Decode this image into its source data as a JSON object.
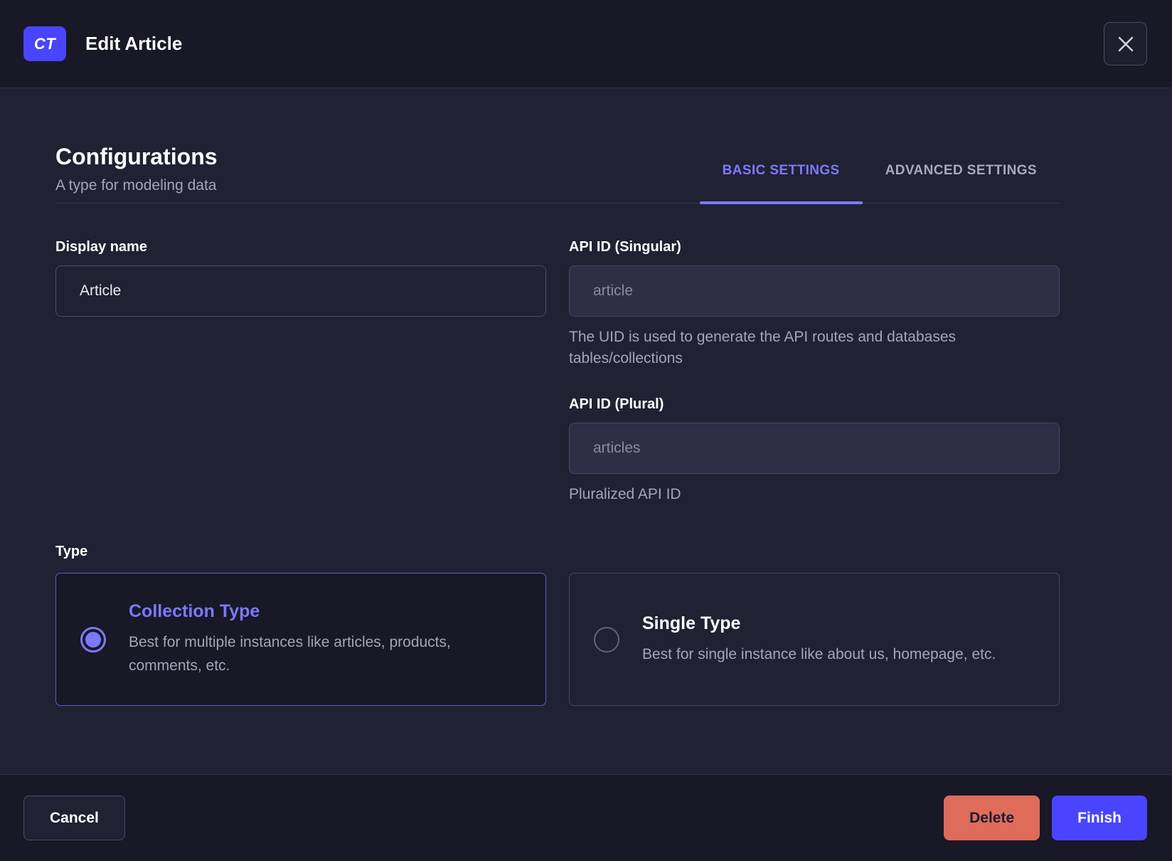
{
  "header": {
    "badge": "CT",
    "title": "Edit Article"
  },
  "config": {
    "title": "Configurations",
    "subtitle": "A type for modeling data",
    "tabs": [
      {
        "label": "BASIC SETTINGS",
        "active": true
      },
      {
        "label": "ADVANCED SETTINGS",
        "active": false
      }
    ]
  },
  "fields": {
    "display_name": {
      "label": "Display name",
      "value": "Article"
    },
    "api_singular": {
      "label": "API ID (Singular)",
      "placeholder": "article",
      "helper": "The UID is used to generate the API routes and databases tables/collections"
    },
    "api_plural": {
      "label": "API ID (Plural)",
      "placeholder": "articles",
      "helper": "Pluralized API ID"
    }
  },
  "type_section": {
    "label": "Type",
    "options": [
      {
        "title": "Collection Type",
        "description": "Best for multiple instances like articles, products, comments, etc.",
        "selected": true
      },
      {
        "title": "Single Type",
        "description": "Best for single instance like about us, homepage, etc.",
        "selected": false
      }
    ]
  },
  "footer": {
    "cancel": "Cancel",
    "delete": "Delete",
    "finish": "Finish"
  },
  "icons": {
    "close": "close-icon"
  },
  "colors": {
    "primary": "#4945ff",
    "primary_light": "#7b79ff",
    "danger": "#df6b5b",
    "header_bg": "#181826",
    "body_bg": "#212134",
    "border": "#4a4a6a",
    "text_muted": "#a5a5ba"
  }
}
